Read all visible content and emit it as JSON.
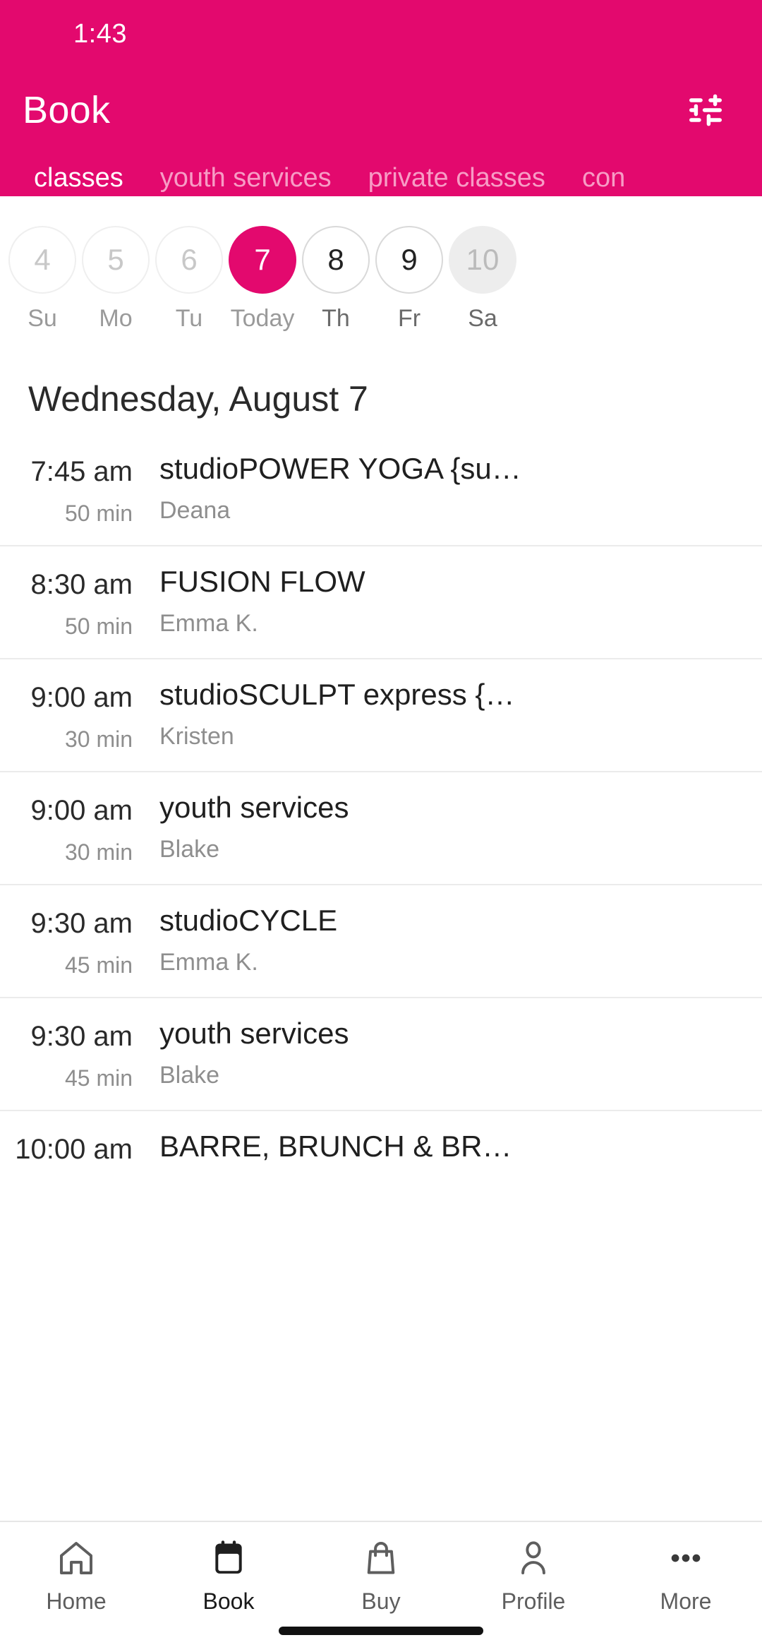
{
  "statusbar": {
    "time": "1:43"
  },
  "header": {
    "title": "Book",
    "accent_color": "#E3096E",
    "filter_icon": "tune-icon",
    "tabs": [
      {
        "label": "classes",
        "active": true
      },
      {
        "label": "youth services",
        "active": false
      },
      {
        "label": "private classes",
        "active": false
      },
      {
        "label": "con",
        "active": false
      }
    ]
  },
  "datepicker": {
    "days": [
      {
        "num": "4",
        "label": "Su",
        "state": "disabled"
      },
      {
        "num": "5",
        "label": "Mo",
        "state": "disabled"
      },
      {
        "num": "6",
        "label": "Tu",
        "state": "disabled"
      },
      {
        "num": "7",
        "label": "Today",
        "state": "selected"
      },
      {
        "num": "8",
        "label": "Th",
        "state": "enabled"
      },
      {
        "num": "9",
        "label": "Fr",
        "state": "enabled"
      },
      {
        "num": "10",
        "label": "Sa",
        "state": "filled"
      }
    ]
  },
  "day_heading": "Wednesday, August 7",
  "classes": [
    {
      "time": "7:45 am",
      "duration": "50 min",
      "name": "studioPOWER YOGA {su…",
      "instructor": "Deana"
    },
    {
      "time": "8:30 am",
      "duration": "50 min",
      "name": "FUSION FLOW",
      "instructor": "Emma K."
    },
    {
      "time": "9:00 am",
      "duration": "30 min",
      "name": "studioSCULPT express {…",
      "instructor": "Kristen"
    },
    {
      "time": "9:00 am",
      "duration": "30 min",
      "name": "youth services",
      "instructor": "Blake"
    },
    {
      "time": "9:30 am",
      "duration": "45 min",
      "name": "studioCYCLE",
      "instructor": "Emma K."
    },
    {
      "time": "9:30 am",
      "duration": "45 min",
      "name": "youth services",
      "instructor": "Blake"
    },
    {
      "time": "10:00 am",
      "duration": "",
      "name": "BARRE, BRUNCH & BR…",
      "instructor": ""
    }
  ],
  "bottomnav": [
    {
      "label": "Home",
      "icon": "home-icon",
      "active": false
    },
    {
      "label": "Book",
      "icon": "calendar-icon",
      "active": true
    },
    {
      "label": "Buy",
      "icon": "bag-icon",
      "active": false
    },
    {
      "label": "Profile",
      "icon": "person-icon",
      "active": false
    },
    {
      "label": "More",
      "icon": "dots-icon",
      "active": false
    }
  ]
}
